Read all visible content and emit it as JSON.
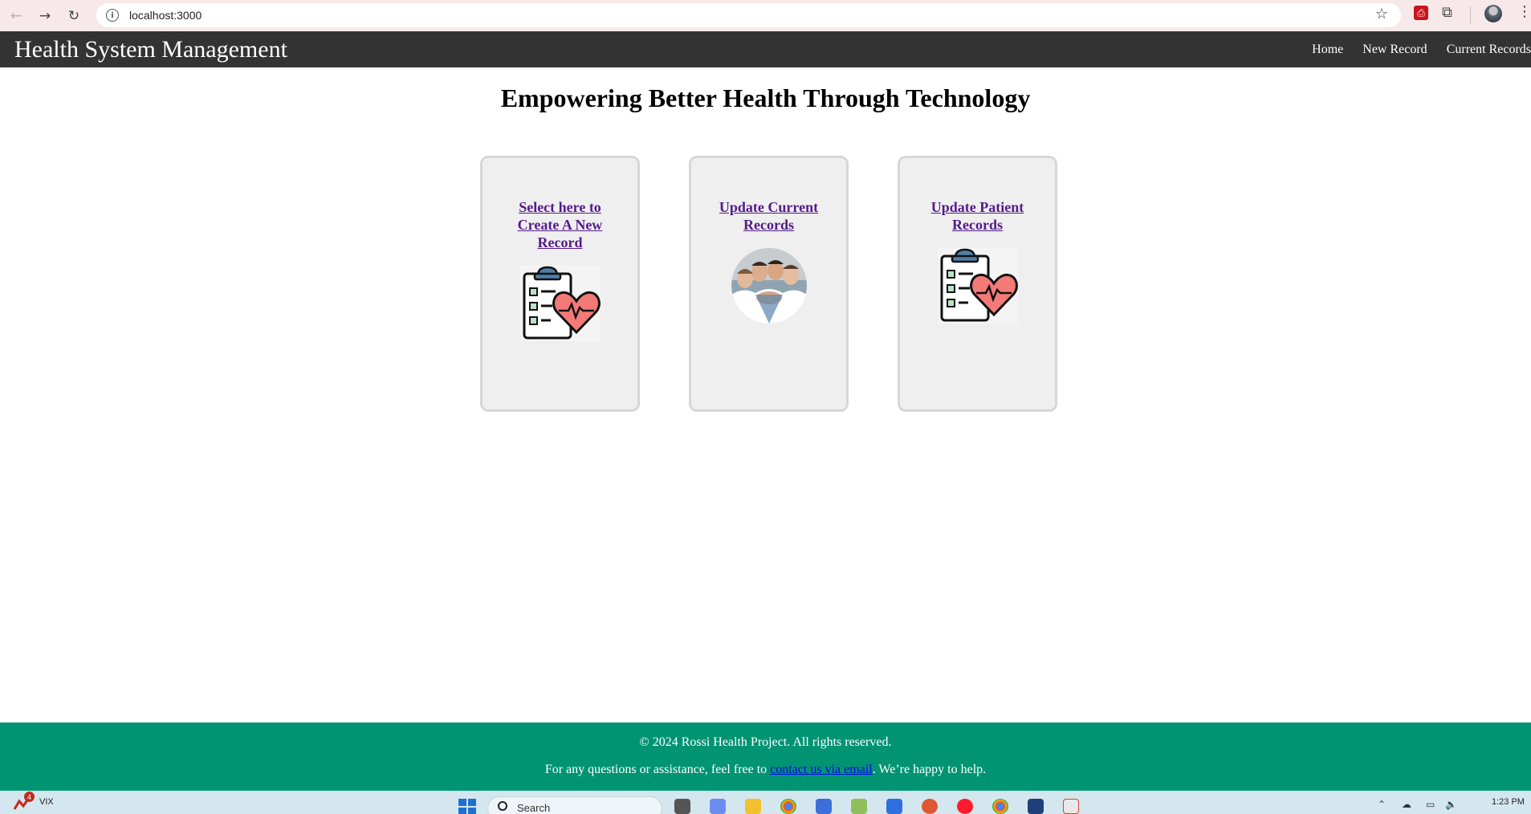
{
  "browser": {
    "url": "localhost:3000",
    "back_icon": "arrow-left-icon",
    "forward_icon": "arrow-right-icon",
    "reload_icon": "reload-icon",
    "site_info_icon": "info-icon",
    "bookmark_icon": "star-icon",
    "extensions_icon": "puzzle-icon",
    "menu_icon": "kebab-menu-icon"
  },
  "header": {
    "title": "Health System Management",
    "nav": [
      {
        "label": "Home"
      },
      {
        "label": "New Record"
      },
      {
        "label": "Current Records"
      }
    ]
  },
  "main": {
    "headline": "Empowering Better Health Through Technology",
    "cards": [
      {
        "link_text": "Select here to Create A New Record",
        "image": "clipboard-heart-icon"
      },
      {
        "link_text": "Update Current Records",
        "image": "medical-team-photo"
      },
      {
        "link_text": "Update Patient Records",
        "image": "clipboard-heart-icon"
      }
    ]
  },
  "footer": {
    "copyright": "© 2024 Rossi Health Project. All rights reserved.",
    "contact_prefix": "For any questions or assistance, feel free to ",
    "contact_link": "contact us via email",
    "contact_suffix": ". We’re happy to help."
  },
  "taskbar": {
    "notification_count": "4",
    "ticker": "VIX",
    "search_label": "Search",
    "time": "1:23 PM"
  },
  "colors": {
    "header_bg": "#333333",
    "footer_bg": "#009473",
    "card_bg": "#efefef",
    "visited_link": "#551a8b",
    "browser_bar": "#f7e9ea",
    "taskbar": "#d5e7ee"
  }
}
